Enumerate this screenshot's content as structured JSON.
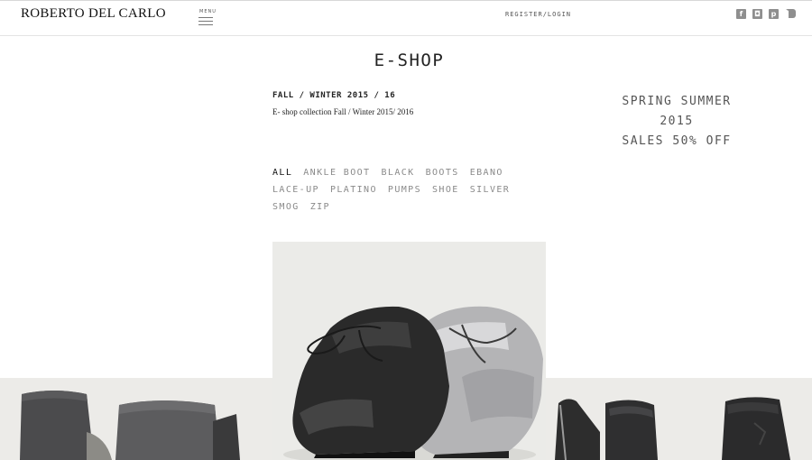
{
  "header": {
    "brand": "ROBERTO DEL CARLO",
    "menu_label": "MENU",
    "register_login": "REGISTER/LOGIN",
    "social": [
      {
        "icon": "facebook-icon",
        "glyph": "f"
      },
      {
        "icon": "instagram-icon",
        "glyph": "◘"
      },
      {
        "icon": "pinterest-icon",
        "glyph": "p"
      },
      {
        "icon": "youtube-icon",
        "glyph": ""
      }
    ]
  },
  "main": {
    "page_title": "E-SHOP",
    "collection_title": "FALL / WINTER 2015 / 16",
    "collection_description": "E- shop collection Fall / Winter  2015/ 2016",
    "promo": {
      "line1": "SPRING SUMMER",
      "line2": "2015",
      "line3": "SALES 50% OFF"
    },
    "filters": [
      {
        "label": "ALL",
        "active": true
      },
      {
        "label": "ANKLE BOOT",
        "active": false
      },
      {
        "label": "BLACK",
        "active": false
      },
      {
        "label": "BOOTS",
        "active": false
      },
      {
        "label": "EBANO",
        "active": false
      },
      {
        "label": "LACE-UP",
        "active": false
      },
      {
        "label": "PLATINO",
        "active": false
      },
      {
        "label": "PUMPS",
        "active": false
      },
      {
        "label": "SHOE",
        "active": false
      },
      {
        "label": "SILVER",
        "active": false
      },
      {
        "label": "SMOG",
        "active": false
      },
      {
        "label": "ZIP",
        "active": false
      }
    ]
  },
  "products": [
    {
      "image": "grey-felt-boots"
    },
    {
      "image": "black-and-silver-lace-up-shoes"
    },
    {
      "image": "black-zip-ankle-boot"
    },
    {
      "image": "black-leather-boot"
    }
  ],
  "colors": {
    "text": "#222222",
    "muted": "#8a8a8a",
    "promo": "#555555",
    "icon": "#8f8f8f",
    "band": "#ececea"
  }
}
